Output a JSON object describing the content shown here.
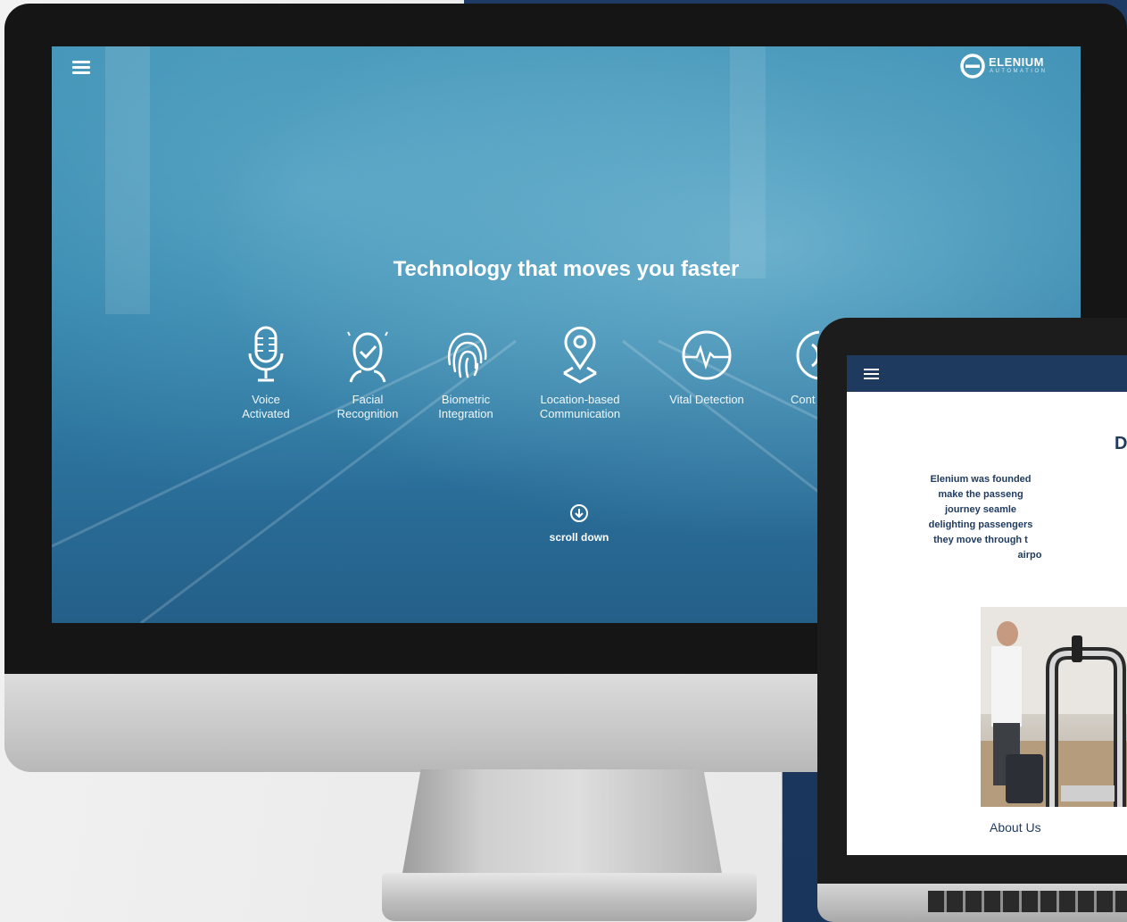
{
  "desktop": {
    "brand": {
      "name": "ELENIUM",
      "tagline": "AUTOMATION"
    },
    "hero_title": "Technology that moves you faster",
    "features": [
      {
        "icon": "microphone-icon",
        "label_line1": "Voice",
        "label_line2": "Activated"
      },
      {
        "icon": "face-check-icon",
        "label_line1": "Facial",
        "label_line2": "Recognition"
      },
      {
        "icon": "fingerprint-icon",
        "label_line1": "Biometric",
        "label_line2": "Integration"
      },
      {
        "icon": "location-pin-icon",
        "label_line1": "Location-based",
        "label_line2": "Communication"
      },
      {
        "icon": "heartbeat-icon",
        "label_line1": "Vital Detection",
        "label_line2": ""
      },
      {
        "icon": "contactless-icon",
        "label_line1": "Cont",
        "label_line2": ""
      }
    ],
    "scroll_label": "scroll down"
  },
  "laptop": {
    "heading": "D",
    "paragraph": [
      "Elenium was founded",
      "make the passeng",
      "journey seamle",
      "delighting passengers",
      "they move through t",
      "airpo"
    ],
    "about_label": "About Us"
  },
  "colors": {
    "navy": "#1e3a5f",
    "hero_blue": "#2f82aa",
    "white": "#ffffff"
  }
}
